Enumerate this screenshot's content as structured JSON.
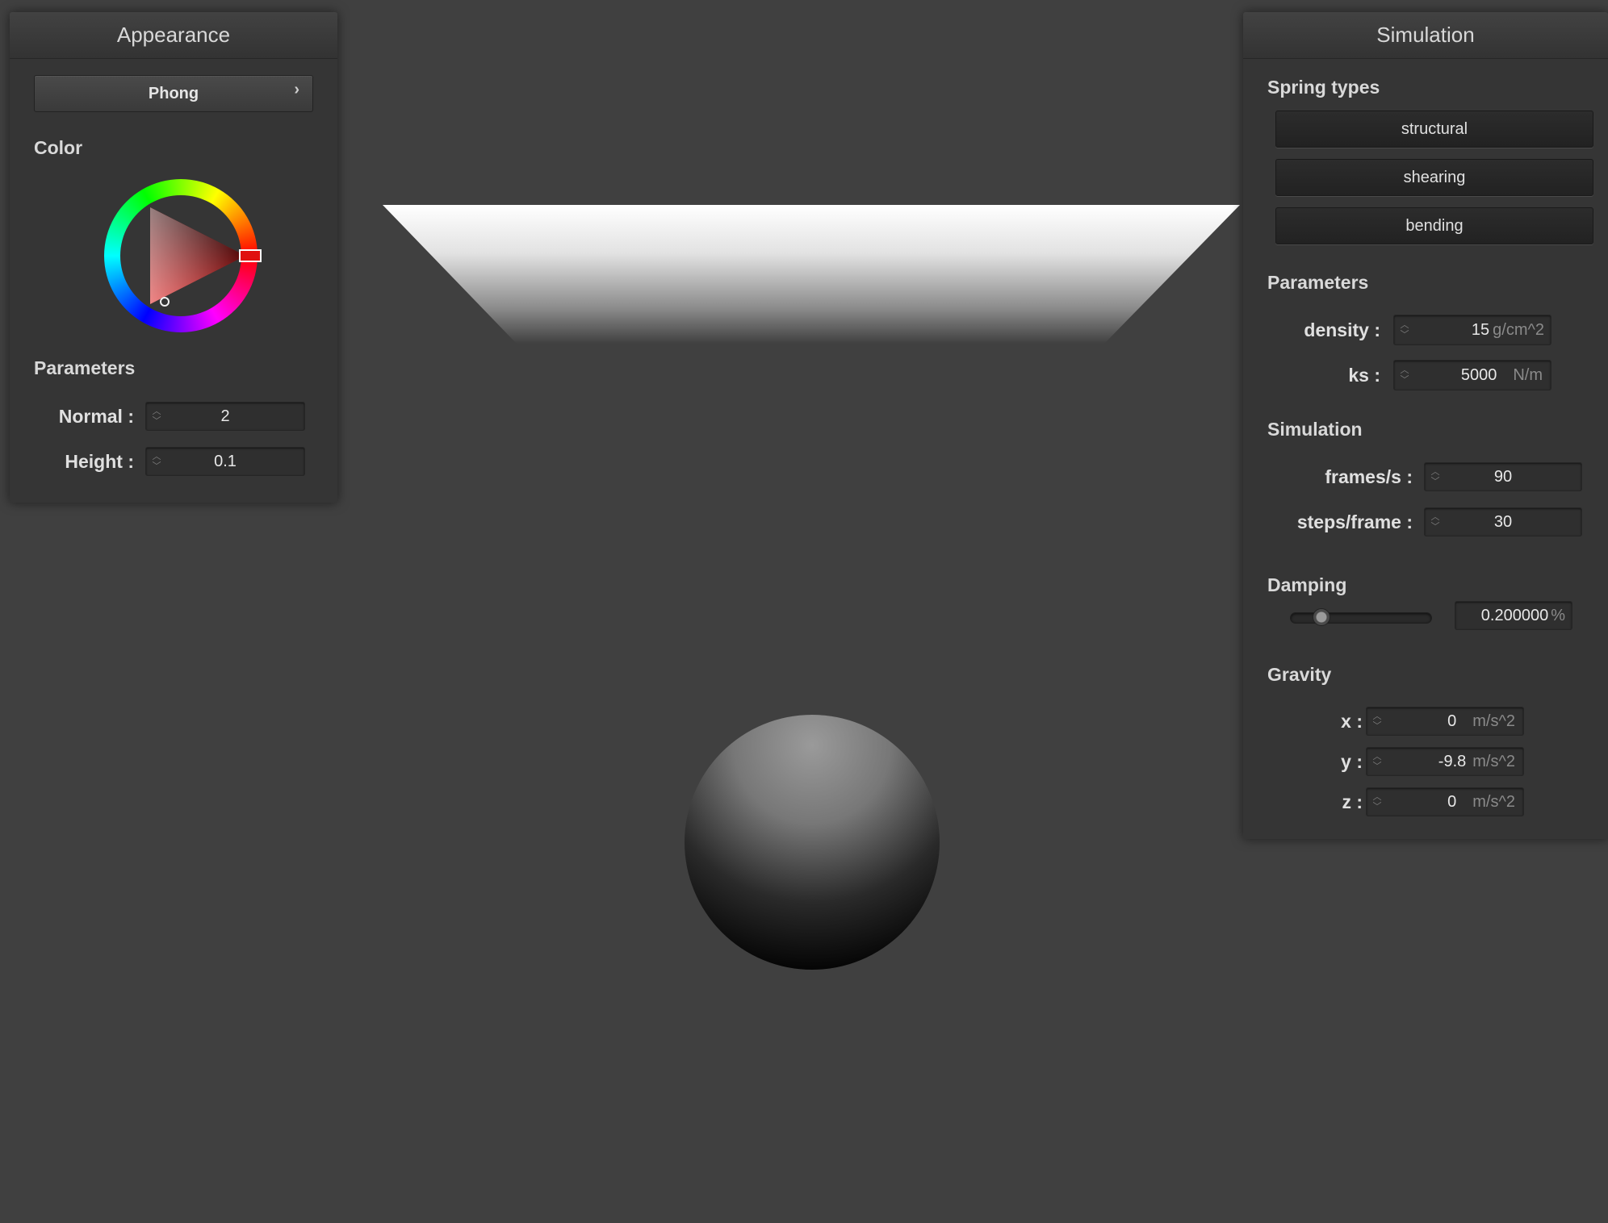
{
  "appearance": {
    "title": "Appearance",
    "shader": "Phong",
    "color_label": "Color",
    "selected_color": "#e01010",
    "parameters_label": "Parameters",
    "normal": {
      "label": "Normal :",
      "value": "2"
    },
    "height": {
      "label": "Height :",
      "value": "0.1"
    }
  },
  "simulation": {
    "title": "Simulation",
    "spring_types_label": "Spring types",
    "spring_types": [
      "structural",
      "shearing",
      "bending"
    ],
    "parameters_label": "Parameters",
    "density": {
      "label": "density :",
      "value": "15",
      "unit": "g/cm^2"
    },
    "ks": {
      "label": "ks :",
      "value": "5000",
      "unit": "N/m"
    },
    "simulation_label": "Simulation",
    "frames_per_second": {
      "label": "frames/s :",
      "value": "90"
    },
    "steps_per_frame": {
      "label": "steps/frame :",
      "value": "30"
    },
    "damping_label": "Damping",
    "damping": {
      "value": "0.200000",
      "unit": "%",
      "slider_fraction": 0.2
    },
    "gravity_label": "Gravity",
    "gravity": [
      {
        "label": "x :",
        "value": "0",
        "unit": "m/s^2"
      },
      {
        "label": "y :",
        "value": "-9.8",
        "unit": "m/s^2"
      },
      {
        "label": "z :",
        "value": "0",
        "unit": "m/s^2"
      }
    ]
  },
  "colors": {
    "background": "#404040",
    "panel": "#353535",
    "cloth_highlight": "#ffffff"
  }
}
